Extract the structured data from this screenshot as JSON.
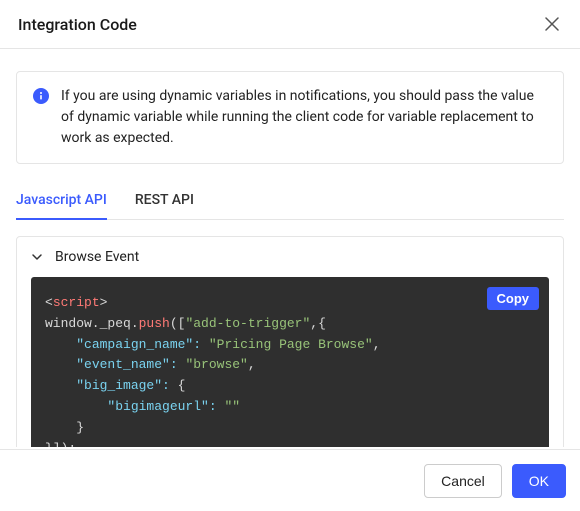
{
  "header": {
    "title": "Integration Code"
  },
  "info": {
    "text": "If you are using dynamic variables in notifications, you should pass the value of dynamic variable while running the client code for variable replacement to work as expected."
  },
  "tabs": {
    "js": "Javascript API",
    "rest": "REST API"
  },
  "accordion": {
    "title": "Browse Event"
  },
  "copy_label": "Copy",
  "code": {
    "tag_open": "script",
    "obj": "window._peq.",
    "push": "push",
    "open": "([",
    "trigger": "\"add-to-trigger\"",
    "after_trigger": ",{",
    "campaign_key": "\"campaign_name\":",
    "campaign_val": "\"Pricing Page Browse\"",
    "event_key": "\"event_name\":",
    "event_val": "\"browse\"",
    "bigimg_key": "\"big_image\":",
    "bigimg_open": "{",
    "bigimgurl_key": "\"bigimageurl\":",
    "bigimgurl_val": "\"\"",
    "inner_close": "}",
    "outer_close": "}]);"
  },
  "footer": {
    "cancel": "Cancel",
    "ok": "OK"
  }
}
